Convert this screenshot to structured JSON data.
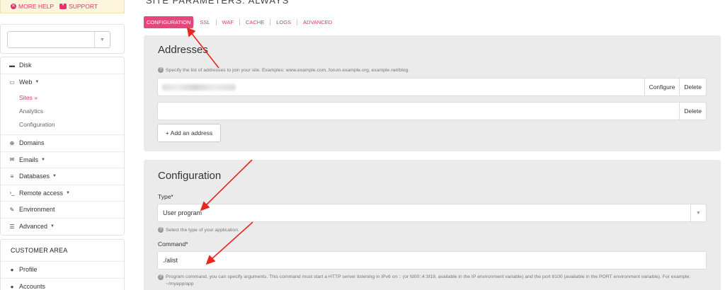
{
  "header": {
    "more_help": "MORE HELP",
    "support": "SUPPORT",
    "page_title": "SITE PARAMETERS: ALWAYS"
  },
  "sidebar": {
    "site_select_value": "",
    "menu": [
      {
        "label": "Disk",
        "icon": "disk-icon"
      },
      {
        "label": "Web",
        "icon": "monitor-icon",
        "has_caret": true
      },
      {
        "label": "Domains",
        "icon": "globe-icon"
      },
      {
        "label": "Emails",
        "icon": "envelope-icon",
        "has_caret": true
      },
      {
        "label": "Databases",
        "icon": "database-icon",
        "has_caret": true
      },
      {
        "label": "Remote access",
        "icon": "terminal-icon",
        "has_caret": true
      },
      {
        "label": "Environment",
        "icon": "wrench-icon"
      },
      {
        "label": "Advanced",
        "icon": "list-icon",
        "has_caret": true
      }
    ],
    "web_subitems": [
      {
        "label": "Sites »",
        "active": true
      },
      {
        "label": "Analytics",
        "active": false
      },
      {
        "label": "Configuration",
        "active": false
      }
    ],
    "customer_area": {
      "title": "CUSTOMER AREA",
      "items": [
        {
          "label": "Profile",
          "icon": "user-icon"
        },
        {
          "label": "Accounts",
          "icon": "users-icon"
        }
      ]
    }
  },
  "tabs": [
    {
      "label": "CONFIGURATION",
      "active": true
    },
    {
      "label": "SSL",
      "active": false
    },
    {
      "label": "WAF",
      "active": false
    },
    {
      "label": "CACHE",
      "active": false
    },
    {
      "label": "LOGS",
      "active": false
    },
    {
      "label": "ADVANCED",
      "active": false
    }
  ],
  "addresses": {
    "title": "Addresses",
    "hint": "Specify the list of addresses to join your site. Examples: www.example.com, forum.example.org, example.net/blog.",
    "rows": [
      {
        "value": "",
        "configure_label": "Configure",
        "delete_label": "Delete"
      },
      {
        "value": "",
        "delete_label": "Delete"
      }
    ],
    "add_label": "+ Add an address"
  },
  "configuration": {
    "title": "Configuration",
    "type_label": "Type*",
    "type_value": "User program",
    "type_hint": "Select the type of your application.",
    "command_label": "Command*",
    "command_value": "./alist",
    "command_hint": "Program command, you can specify arguments. This command must start a HTTP server listening in IPv6 on :: (or fd00::4:3f19, available in the IP environment variable) and the port 8100 (available in the PORT environment variable). For example: ~/myapp/app"
  },
  "colors": {
    "accent": "#e2326f",
    "panel_bg": "#ebebeb",
    "help_bg": "#fdf5dc",
    "arrow": "#e8261c"
  }
}
